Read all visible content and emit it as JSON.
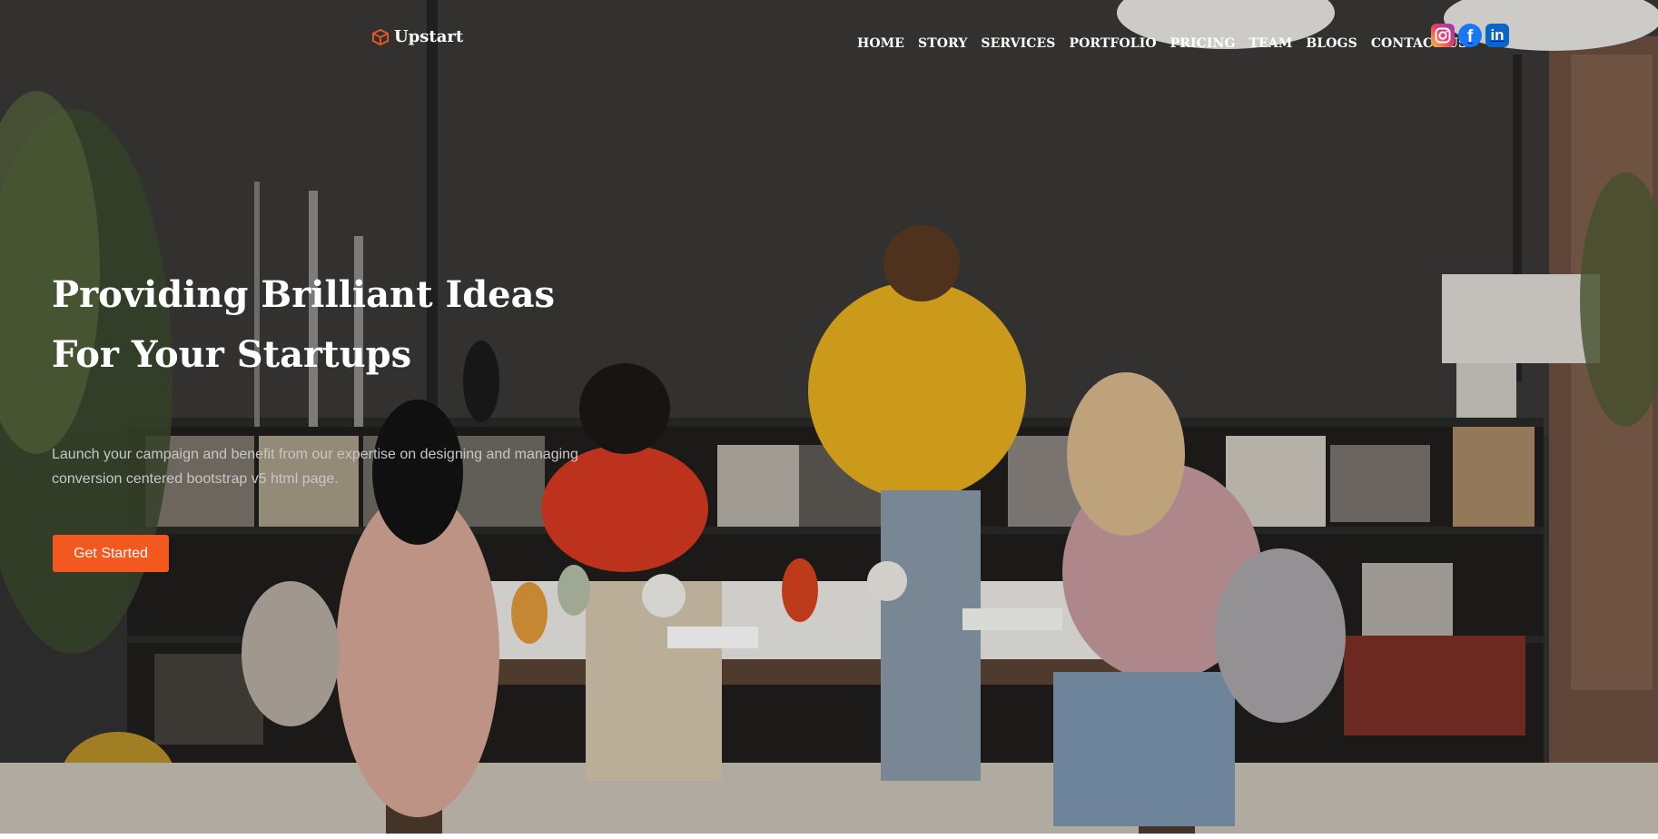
{
  "brand": {
    "name": "Upstart",
    "logo_icon": "cube-icon",
    "accent": "#f3581f"
  },
  "nav": {
    "items": [
      "HOME",
      "STORY",
      "SERVICES",
      "PORTFOLIO",
      "PRICING",
      "TEAM",
      "BLOGS",
      "CONTACT US"
    ]
  },
  "social": [
    {
      "name": "instagram-icon",
      "label": "Instagram"
    },
    {
      "name": "facebook-icon",
      "label": "f"
    },
    {
      "name": "linkedin-icon",
      "label": "in"
    }
  ],
  "hero": {
    "headline_line1": "Providing Brilliant Ideas",
    "headline_line2": "For Your Startups",
    "lead": "Launch your campaign and benefit from our expertise on designing and managing conversion centered bootstrap v5 html page.",
    "cta_label": "Get Started",
    "cta_color": "#f3581f",
    "background_image": "team-working-at-table-photo"
  }
}
